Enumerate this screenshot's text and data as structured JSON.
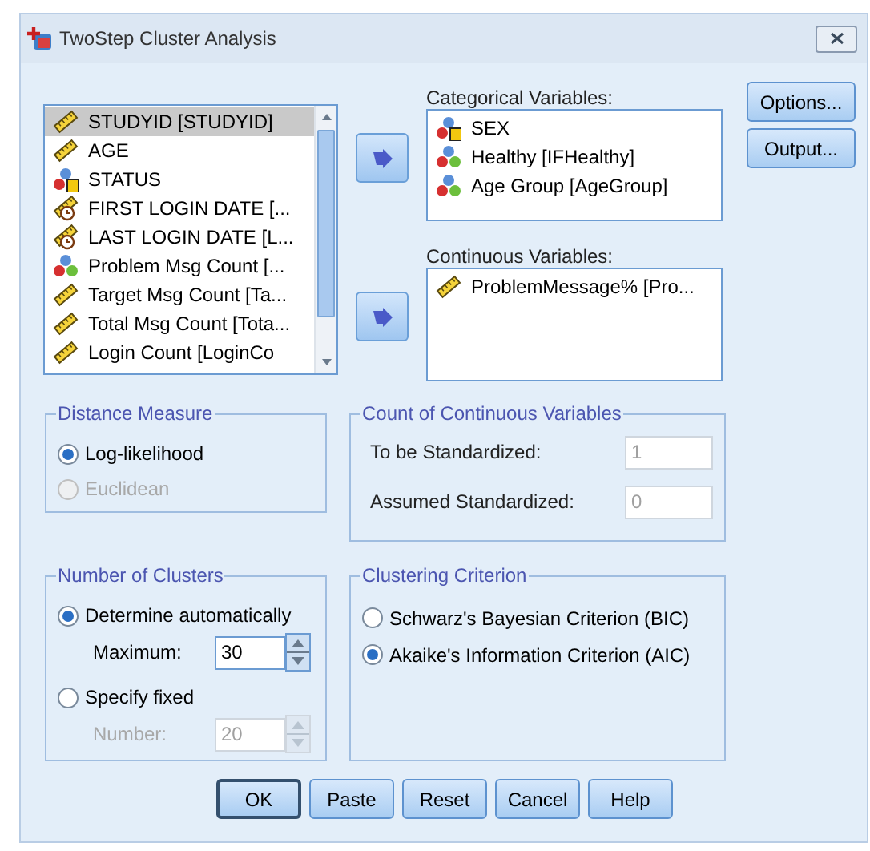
{
  "window": {
    "title": "TwoStep Cluster Analysis"
  },
  "source_variables": [
    {
      "label": "STUDYID  [STUDYID]",
      "kind": "scale",
      "selected": true
    },
    {
      "label": "AGE",
      "kind": "scale",
      "selected": false
    },
    {
      "label": "STATUS",
      "kind": "nominal_string",
      "selected": false
    },
    {
      "label": "FIRST LOGIN DATE [...",
      "kind": "scale_date",
      "selected": false
    },
    {
      "label": "LAST LOGIN DATE [L...",
      "kind": "scale_date",
      "selected": false
    },
    {
      "label": "Problem Msg Count [...",
      "kind": "nominal",
      "selected": false
    },
    {
      "label": "Target Msg Count [Ta...",
      "kind": "scale",
      "selected": false
    },
    {
      "label": "Total Msg Count [Tota...",
      "kind": "scale",
      "selected": false
    },
    {
      "label": "Login Count [LoginCo",
      "kind": "scale",
      "selected": false
    }
  ],
  "categorical_variables": {
    "label": "Categorical Variables:",
    "items": [
      {
        "label": "SEX",
        "kind": "nominal_string"
      },
      {
        "label": "Healthy [IFHealthy]",
        "kind": "nominal"
      },
      {
        "label": "Age Group [AgeGroup]",
        "kind": "nominal"
      }
    ]
  },
  "continuous_variables": {
    "label": "Continuous Variables:",
    "items": [
      {
        "label": "ProblemMessage% [Pro...",
        "kind": "scale"
      }
    ]
  },
  "side_buttons": [
    "Options...",
    "Output..."
  ],
  "distance_measure": {
    "title": "Distance Measure",
    "options": [
      {
        "label": "Log-likelihood",
        "selected": true,
        "disabled": false
      },
      {
        "label": "Euclidean",
        "selected": false,
        "disabled": true
      }
    ]
  },
  "count_of_continuous_variables": {
    "title": "Count of Continuous Variables",
    "fields": [
      {
        "label": "To be Standardized:",
        "value": "1",
        "disabled": true
      },
      {
        "label": "Assumed Standardized:",
        "value": "0",
        "disabled": true
      }
    ]
  },
  "number_of_clusters": {
    "title": "Number of Clusters",
    "options": [
      {
        "label": "Determine automatically",
        "selected": true,
        "field": {
          "label": "Maximum:",
          "value": "30",
          "disabled": false
        }
      },
      {
        "label": "Specify fixed",
        "selected": false,
        "field": {
          "label": "Number:",
          "value": "20",
          "disabled": true
        }
      }
    ]
  },
  "clustering_criterion": {
    "title": "Clustering Criterion",
    "options": [
      {
        "label": "Schwarz's Bayesian Criterion (BIC)",
        "selected": false,
        "disabled": false
      },
      {
        "label": "Akaike's Information Criterion (AIC)",
        "selected": true,
        "disabled": false
      }
    ]
  },
  "buttons": [
    {
      "label": "OK",
      "default": true
    },
    {
      "label": "Paste",
      "default": false
    },
    {
      "label": "Reset",
      "default": false
    },
    {
      "label": "Cancel",
      "default": false
    },
    {
      "label": "Help",
      "default": false
    }
  ]
}
